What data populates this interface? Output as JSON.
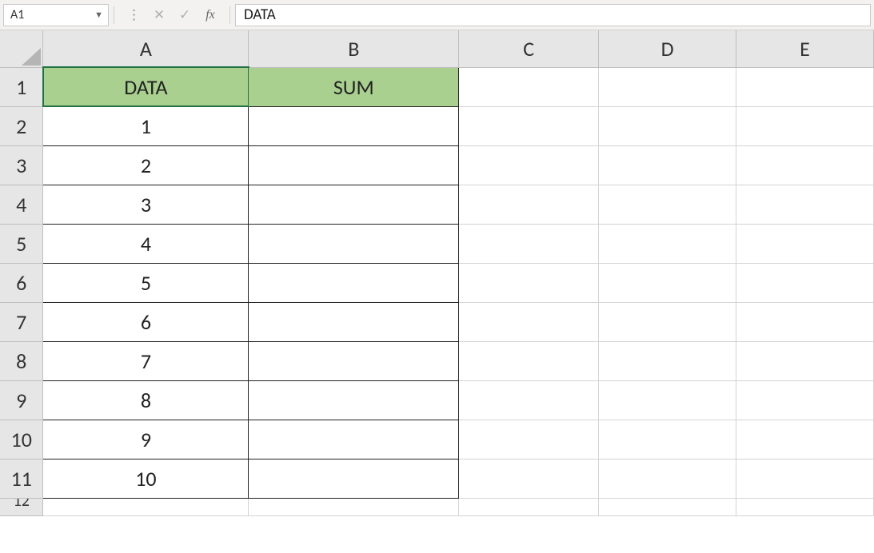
{
  "formulaBar": {
    "nameBox": "A1",
    "formulaValue": "DATA"
  },
  "columns": [
    "A",
    "B",
    "C",
    "D",
    "E"
  ],
  "rows": [
    "1",
    "2",
    "3",
    "4",
    "5",
    "6",
    "7",
    "8",
    "9",
    "10",
    "11"
  ],
  "headerRow": {
    "A": "DATA",
    "B": "SUM"
  },
  "dataCells": {
    "A2": "1",
    "A3": "2",
    "A4": "3",
    "A5": "4",
    "A6": "5",
    "A7": "6",
    "A8": "7",
    "A9": "8",
    "A10": "9",
    "A11": "10"
  },
  "activeCell": "A1",
  "partialNextRow": "12"
}
